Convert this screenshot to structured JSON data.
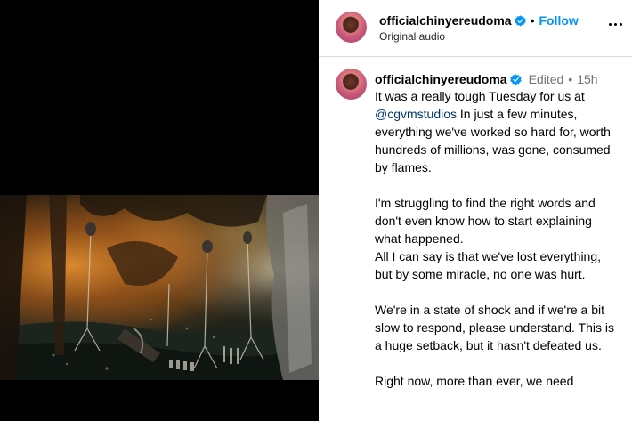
{
  "header": {
    "username": "officialchinyereudoma",
    "separator": "•",
    "follow_label": "Follow",
    "subtitle": "Original audio"
  },
  "caption": {
    "username": "officialchinyereudoma",
    "edited_label": "Edited",
    "separator": "•",
    "time_ago": "15h",
    "line1_pre": "It was a really tough Tuesday for us at",
    "mention": "@cgvmstudios",
    "line1_post": " In just a few minutes, everything we've worked so hard for, worth hundreds of millions, was gone, consumed by flames.",
    "paragraph2": "I'm struggling to find the right words and don't even know how to start explaining what happened.",
    "paragraph2b": "All I can say is that we've lost everything, but by some miracle, no one was hurt.",
    "paragraph3": "We're in a state of shock and if we're a bit slow to respond, please understand. This is a huge setback, but it hasn't defeated us.",
    "paragraph4": "Right now, more than ever, we need"
  },
  "colors": {
    "link_blue": "#0095f6",
    "verified_blue": "#0095f6",
    "mention": "#00376b",
    "muted": "#737373"
  },
  "icons": {
    "verified": "verified-badge-icon",
    "more": "more-options-icon"
  }
}
